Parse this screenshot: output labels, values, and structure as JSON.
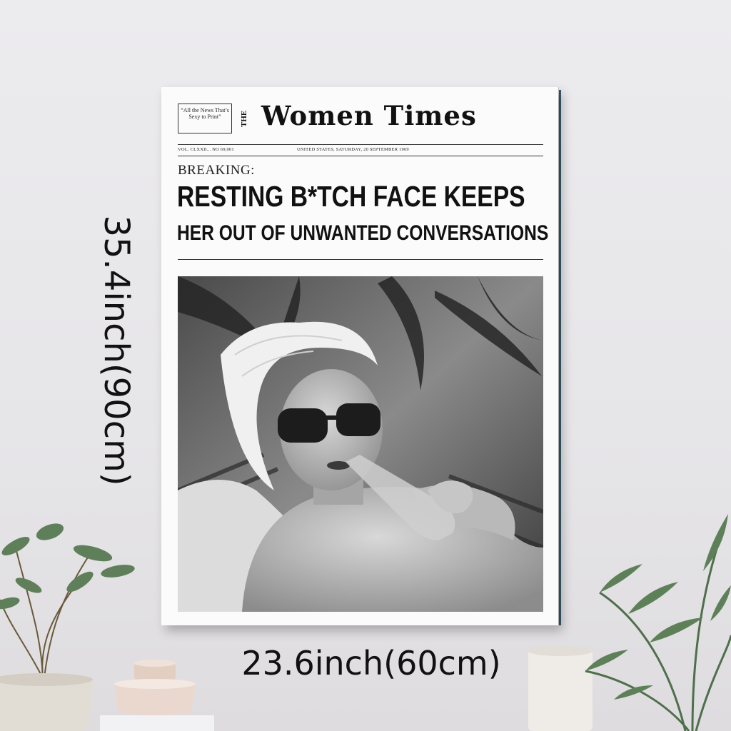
{
  "poster": {
    "motto": "“All the News That’s Sexy to Print”",
    "masthead_prefix": "THE",
    "masthead": "Women Times",
    "issue_left": "VOL. CLXXII... NO 69,001",
    "issue_center": "UNITED STATES, SATURDAY, 20 SEPTEMBER 1969",
    "kicker": "BREAKING:",
    "headline_line1": "RESTING B*TCH FACE KEEPS",
    "headline_line2": "HER OUT OF UNWANTED CONVERSATIONS"
  },
  "dimensions": {
    "height": "35.4inch(90cm)",
    "width": "23.6inch(60cm)"
  },
  "colors": {
    "wall": "#e8e7ea",
    "poster_paper": "#fbfbfb",
    "frame_edge": "#2f5060",
    "ink": "#111111"
  }
}
